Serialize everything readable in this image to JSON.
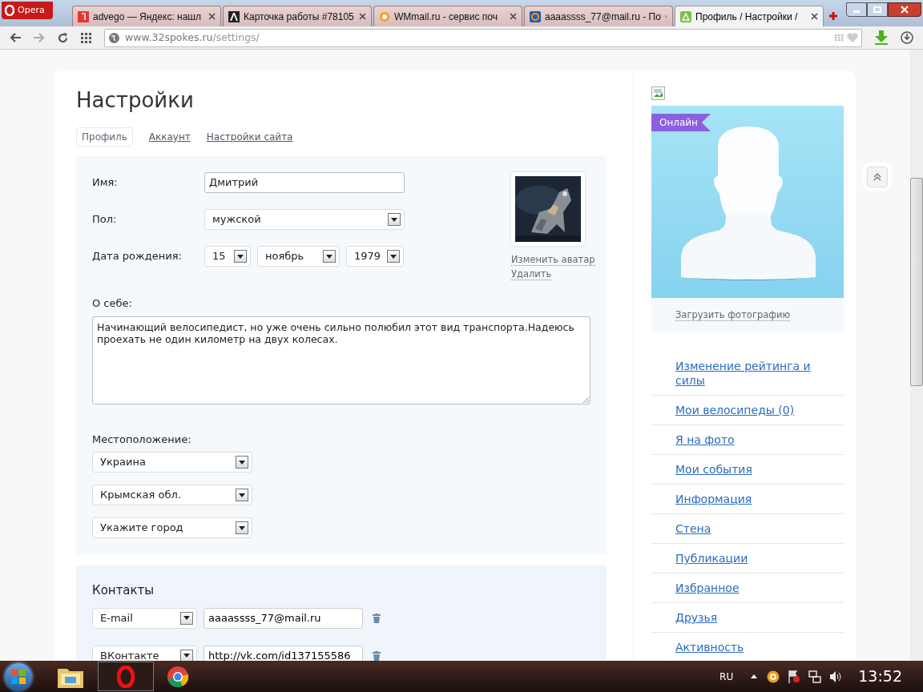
{
  "browser": {
    "menu_label": "Opera",
    "tabs": [
      {
        "label": "advego — Яндекс: нашл",
        "selected": false
      },
      {
        "label": "Карточка работы #78105",
        "selected": false
      },
      {
        "label": "WMmail.ru - сервис поч",
        "selected": false
      },
      {
        "label": "aaaassss_77@mail.ru - По",
        "selected": false
      },
      {
        "label": "Профиль / Настройки /",
        "selected": true
      }
    ],
    "url_host": "www.32spokes.ru",
    "url_path": "/settings/"
  },
  "page": {
    "title": "Настройки",
    "subtabs": [
      {
        "label": "Профиль",
        "selected": true
      },
      {
        "label": "Аккаунт",
        "selected": false
      },
      {
        "label": "Настройки сайта",
        "selected": false
      }
    ],
    "name": {
      "label": "Имя:",
      "value": "Дмитрий"
    },
    "gender": {
      "label": "Пол:",
      "value": "мужской"
    },
    "birthdate": {
      "label": "Дата рождения:",
      "day": "15",
      "month": "ноябрь",
      "year": "1979"
    },
    "avatar_links": [
      "Изменить аватар",
      "Удалить"
    ],
    "about": {
      "label": "О себе:",
      "value": "Начинающий велосипедист, но уже очень сильно полюбил этот вид транспорта.Надеюсь проехать не один километр на двух колесах."
    },
    "location": {
      "label": "Местоположение:",
      "selects": [
        "Украина",
        "Крымская обл.",
        "Укажите город"
      ]
    },
    "contacts": {
      "title": "Контакты",
      "rows": [
        {
          "type": "E-mail",
          "value": "aaaassss_77@mail.ru"
        },
        {
          "type": "ВКонтакте",
          "value": "http://vk.com/id137155586"
        }
      ]
    }
  },
  "sidebar": {
    "badge": "Онлайн",
    "upload_link": "Загрузить фотографию",
    "links": [
      "Изменение рейтинга и силы",
      "Мои велосипеды (0)",
      "Я на фото",
      "Мои события",
      "Информация",
      "Стена",
      "Публикации",
      "Избранное",
      "Друзья",
      "Активность"
    ]
  },
  "taskbar": {
    "language": "RU",
    "clock": "13:52"
  }
}
